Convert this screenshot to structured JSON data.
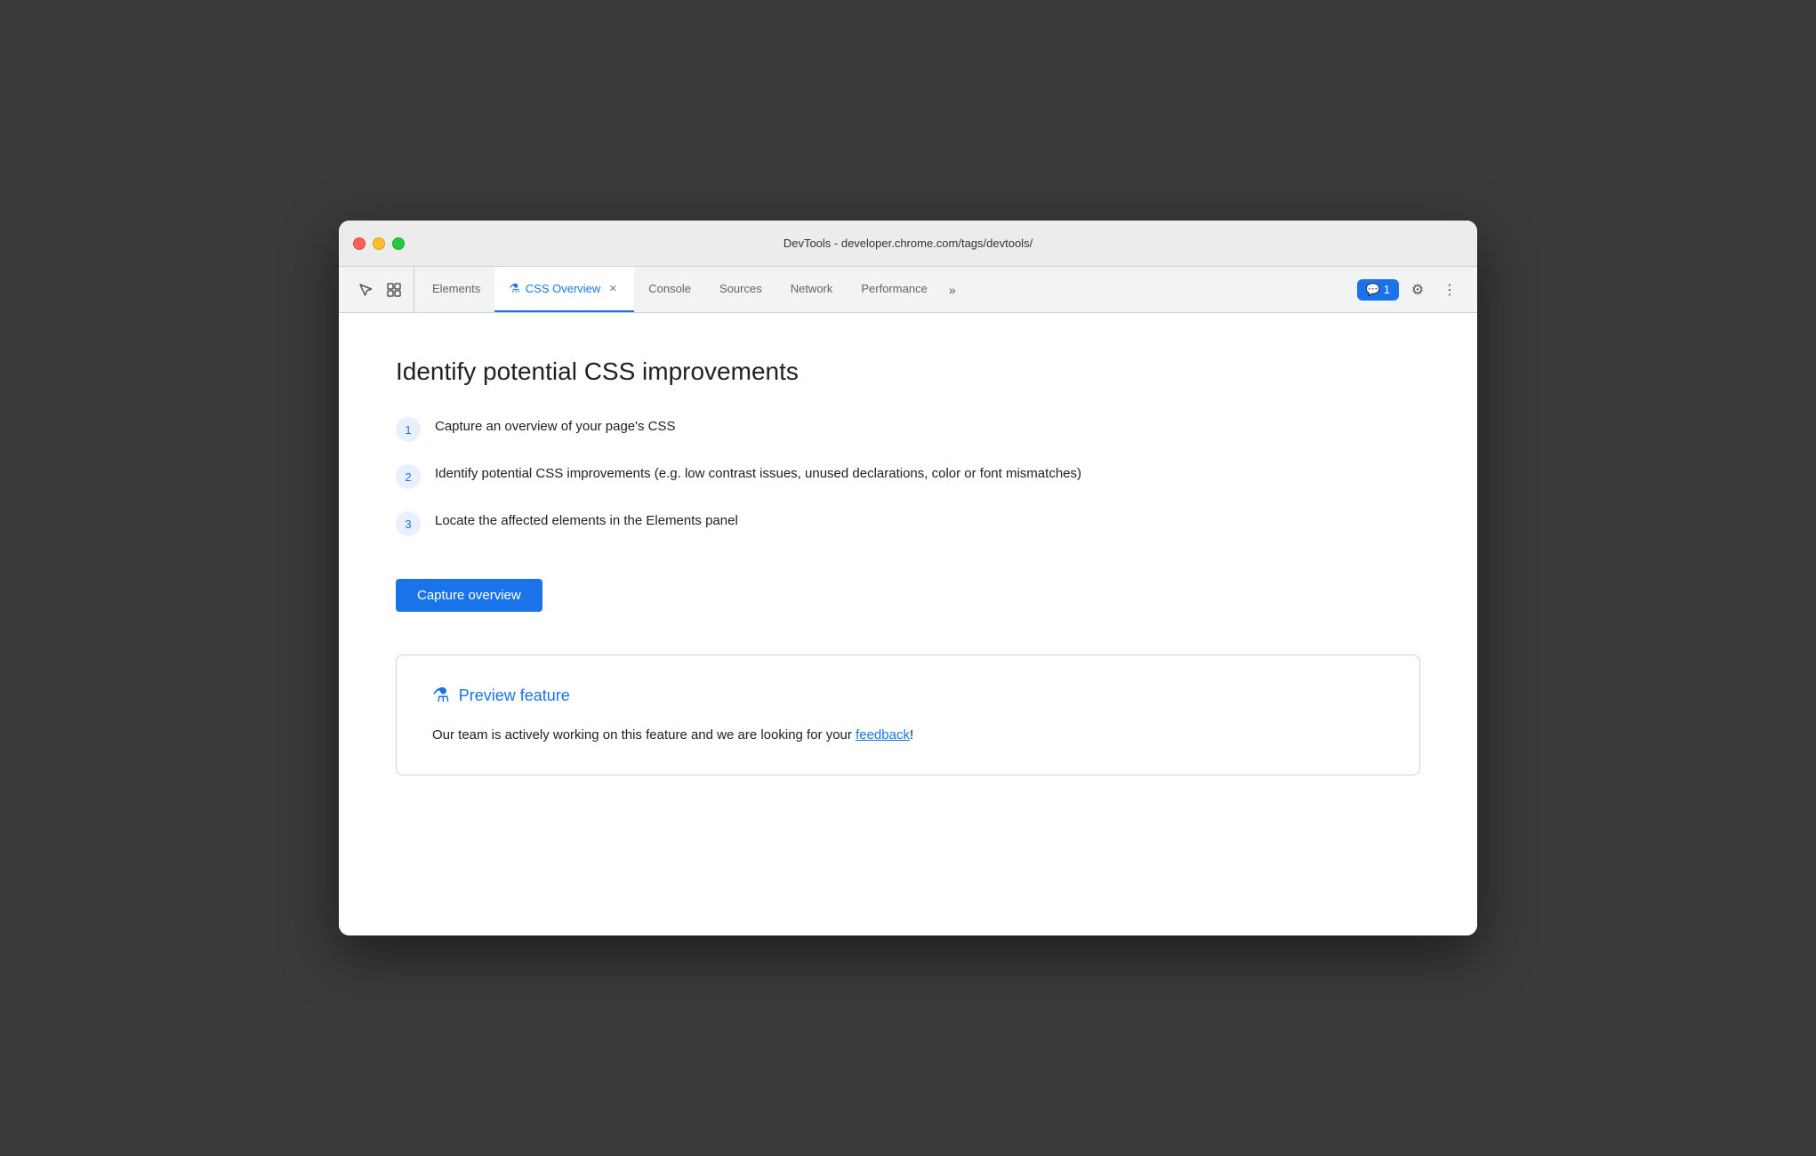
{
  "window": {
    "title": "DevTools - developer.chrome.com/tags/devtools/"
  },
  "titlebar": {
    "url": "DevTools - developer.chrome.com/tags/devtools/"
  },
  "devtools": {
    "tabs": [
      {
        "id": "elements",
        "label": "Elements",
        "active": false,
        "closable": false
      },
      {
        "id": "css-overview",
        "label": "CSS Overview",
        "active": true,
        "closable": true,
        "has_flask": true
      },
      {
        "id": "console",
        "label": "Console",
        "active": false,
        "closable": false
      },
      {
        "id": "sources",
        "label": "Sources",
        "active": false,
        "closable": false
      },
      {
        "id": "network",
        "label": "Network",
        "active": false,
        "closable": false
      },
      {
        "id": "performance",
        "label": "Performance",
        "active": false,
        "closable": false
      }
    ],
    "overflow_label": "»",
    "chat_badge": "1",
    "settings_icon": "⚙",
    "more_icon": "⋮"
  },
  "main": {
    "page_title": "Identify potential CSS improvements",
    "steps": [
      {
        "number": "1",
        "text": "Capture an overview of your page's CSS"
      },
      {
        "number": "2",
        "text": "Identify potential CSS improvements (e.g. low contrast issues, unused declarations, color or font mismatches)"
      },
      {
        "number": "3",
        "text": "Locate the affected elements in the Elements panel"
      }
    ],
    "capture_button_label": "Capture overview",
    "preview": {
      "label": "Preview feature",
      "text_before": "Our team is actively working on this feature and we are looking for your ",
      "link_text": "feedback",
      "text_after": "!"
    }
  }
}
